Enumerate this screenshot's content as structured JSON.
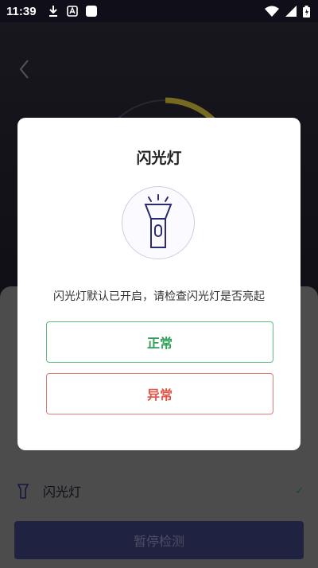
{
  "status_bar": {
    "time": "11:39",
    "icons": [
      "download-icon",
      "text-icon",
      "square-icon",
      "wifi-icon",
      "signal-icon",
      "battery-icon"
    ]
  },
  "nav": {
    "back_icon": "chevron-left-icon"
  },
  "panel": {
    "items": [
      {
        "label": "闪光灯",
        "icon": "flashlight-icon",
        "status_icon": "check-icon"
      }
    ],
    "pause_button": "暂停检测"
  },
  "dialog": {
    "title": "闪光灯",
    "icon": "flashlight-icon",
    "message": "闪光灯默认已开启，请检查闪光灯是否亮起",
    "ok_button": "正常",
    "abnormal_button": "异常"
  },
  "colors": {
    "ok": "#2f9e57",
    "abnormal": "#e0574a",
    "gauge": "#d8c23c",
    "primary_button": "#3a3e76"
  }
}
